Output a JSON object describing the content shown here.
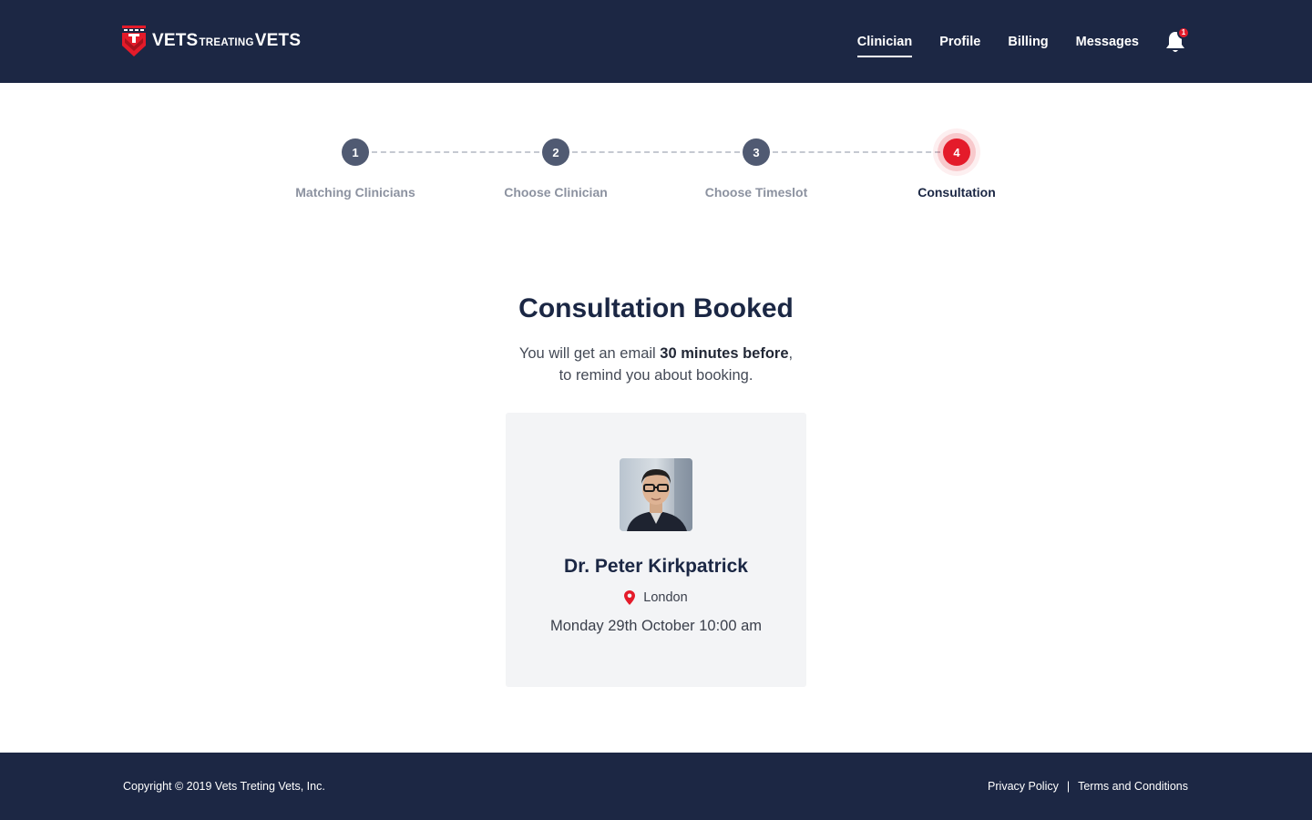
{
  "header": {
    "logo": {
      "text_left": "VETS",
      "text_middle": "TREATING",
      "text_right": "VETS"
    },
    "nav": [
      {
        "label": "Clinician",
        "active": true
      },
      {
        "label": "Profile",
        "active": false
      },
      {
        "label": "Billing",
        "active": false
      },
      {
        "label": "Messages",
        "active": false
      }
    ],
    "notifications": {
      "icon": "bell-icon",
      "badge_count": "1"
    }
  },
  "stepper": {
    "steps": [
      {
        "number": "1",
        "label": "Matching Clinicians",
        "state": "done"
      },
      {
        "number": "2",
        "label": "Choose Clinician",
        "state": "done"
      },
      {
        "number": "3",
        "label": "Choose Timeslot",
        "state": "done"
      },
      {
        "number": "4",
        "label": "Consultation",
        "state": "active"
      }
    ]
  },
  "main": {
    "title": "Consultation Booked",
    "subtitle_before": "You will get an email ",
    "subtitle_bold": "30 minutes before",
    "subtitle_after_comma": ",",
    "subtitle_line2": "to remind you about booking."
  },
  "card": {
    "avatar_icon": "clinician-photo",
    "name": "Dr. Peter Kirkpatrick",
    "location_icon": "map-pin-icon",
    "location": "London",
    "datetime": "Monday 29th October 10:00 am"
  },
  "footer": {
    "copyright": "Copyright © 2019 Vets Treting Vets, Inc.",
    "links": [
      "Privacy Policy",
      "Terms and Conditions"
    ],
    "separator": "|"
  },
  "colors": {
    "navy": "#1c2744",
    "accent_red": "#e41b2a",
    "step_gray": "#505a72",
    "card_bg": "#f3f4f6"
  }
}
